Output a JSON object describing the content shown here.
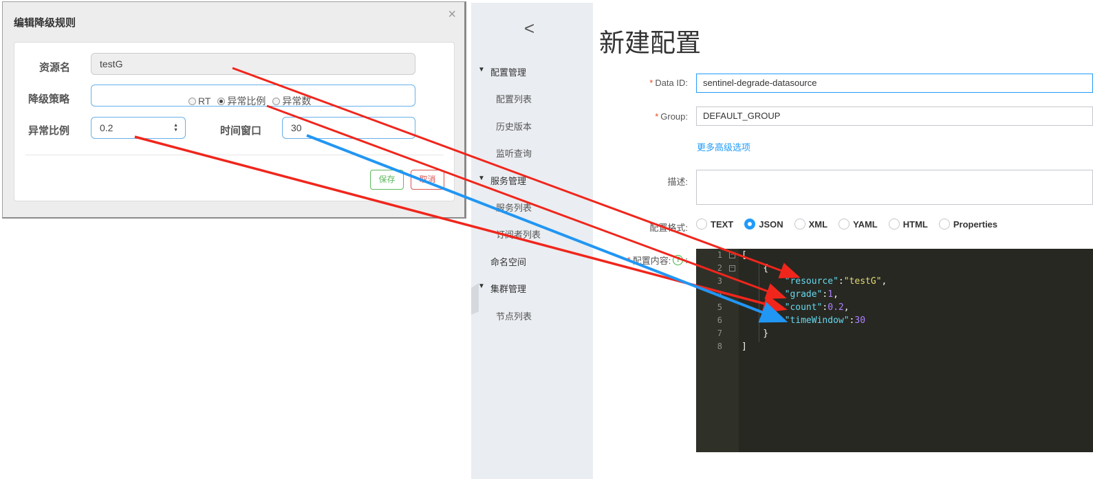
{
  "dialog": {
    "title": "编辑降级规则",
    "close_glyph": "×",
    "resource_label": "资源名",
    "resource_value": "testG",
    "strategy_label": "降级策略",
    "strategy_options": [
      "RT",
      "异常比例",
      "异常数"
    ],
    "strategy_selected": "异常比例",
    "ratio_label": "异常比例",
    "ratio_value": "0.2",
    "window_label": "时间窗口",
    "window_value": "30",
    "save_label": "保存",
    "cancel_label": "取消"
  },
  "sidebar": {
    "back_glyph": "<",
    "groups": [
      {
        "label": "配置管理",
        "items": [
          "配置列表",
          "历史版本",
          "监听查询"
        ]
      },
      {
        "label": "服务管理",
        "items": [
          "服务列表",
          "订阅者列表"
        ]
      },
      {
        "label": "命名空间",
        "items": []
      },
      {
        "label": "集群管理",
        "items": [
          "节点列表"
        ]
      }
    ]
  },
  "main": {
    "title": "新建配置",
    "data_id_label": "Data ID:",
    "data_id_value": "sentinel-degrade-datasource",
    "group_label": "Group:",
    "group_value": "DEFAULT_GROUP",
    "advanced_link": "更多高级选项",
    "desc_label": "描述:",
    "format_label": "配置格式:",
    "formats": [
      "TEXT",
      "JSON",
      "XML",
      "YAML",
      "HTML",
      "Properties"
    ],
    "format_selected": "JSON",
    "content_label": "配置内容:",
    "help_glyph": "?",
    "colon": ":"
  },
  "editor": {
    "line_numbers": [
      "1",
      "2",
      "3",
      "4",
      "5",
      "6",
      "7",
      "8"
    ],
    "lines": [
      {
        "parts": [
          [
            "p",
            "["
          ]
        ]
      },
      {
        "parts": [
          [
            "p",
            "    {"
          ]
        ]
      },
      {
        "parts": [
          [
            "p",
            "        "
          ],
          [
            "k",
            "\"resource\""
          ],
          [
            "p",
            ":"
          ],
          [
            "s",
            "\"testG\""
          ],
          [
            "p",
            ","
          ]
        ]
      },
      {
        "parts": [
          [
            "p",
            "        "
          ],
          [
            "k",
            "\"grade\""
          ],
          [
            "p",
            ":"
          ],
          [
            "n",
            "1"
          ],
          [
            "p",
            ","
          ]
        ]
      },
      {
        "parts": [
          [
            "p",
            "        "
          ],
          [
            "k",
            "\"count\""
          ],
          [
            "p",
            ":"
          ],
          [
            "n",
            "0.2"
          ],
          [
            "p",
            ","
          ]
        ]
      },
      {
        "parts": [
          [
            "p",
            "        "
          ],
          [
            "k",
            "\"timeWindow\""
          ],
          [
            "p",
            ":"
          ],
          [
            "n",
            "30"
          ]
        ]
      },
      {
        "parts": [
          [
            "p",
            "    }"
          ]
        ]
      },
      {
        "parts": [
          [
            "p",
            "]"
          ]
        ]
      }
    ]
  },
  "colors": {
    "annotation_red": "#f0261c",
    "annotation_blue": "#2196f3",
    "link_blue": "#209bfa",
    "editor_bg": "#272822"
  }
}
